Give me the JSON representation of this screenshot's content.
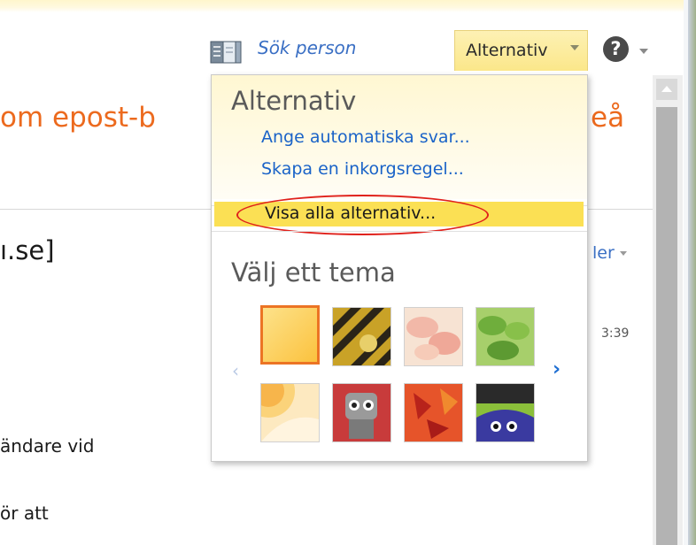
{
  "toolbar": {
    "search_person_label": "Sök person",
    "options_label": "Alternativ",
    "help_glyph": "?"
  },
  "message": {
    "subject_visible": "om epost-b",
    "subject_tail": "eå",
    "sender_visible": "ı.se]",
    "reply_label_visible": "ler",
    "time_visible": "3:39",
    "body_line1": "ändare vid",
    "body_line2": "ör att"
  },
  "menu": {
    "heading": "Alternativ",
    "auto_reply": "Ange automatiska svar...",
    "inbox_rule": "Skapa en inkorgsregel...",
    "show_all": "Visa alla alternativ...",
    "theme_heading": "Välj ett tema",
    "themes": [
      {
        "name": "yellow",
        "selected": true
      },
      {
        "name": "hazard-stripes",
        "selected": false
      },
      {
        "name": "pink-petals",
        "selected": false
      },
      {
        "name": "green-leaves",
        "selected": false
      },
      {
        "name": "sunrise",
        "selected": false
      },
      {
        "name": "robot",
        "selected": false
      },
      {
        "name": "autumn-leaves",
        "selected": false
      },
      {
        "name": "monster",
        "selected": false
      }
    ]
  },
  "colors": {
    "accent_orange": "#ec6a1e",
    "link_blue": "#1a63c8",
    "highlight_yellow": "#fbe054",
    "annotation_red": "#e0211b"
  },
  "icons": {
    "address_book": "address-book-icon",
    "help": "help-icon",
    "prev": "chevron-left-icon",
    "next": "chevron-right-icon"
  }
}
